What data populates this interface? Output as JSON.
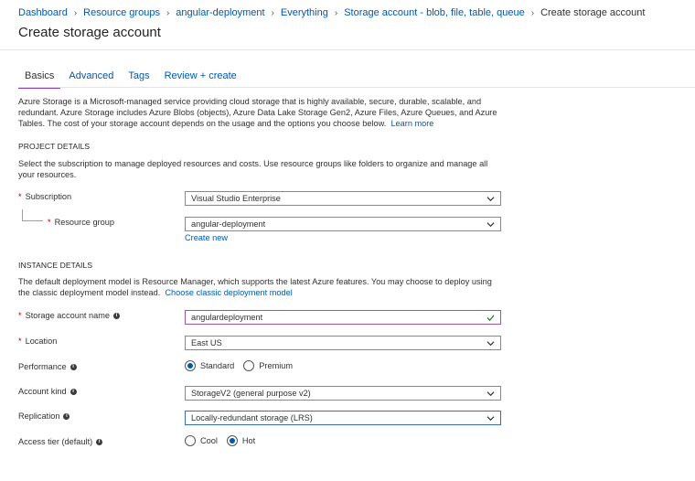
{
  "breadcrumb": {
    "items": [
      "Dashboard",
      "Resource groups",
      "angular-deployment",
      "Everything",
      "Storage account - blob, file, table, queue"
    ],
    "current": "Create storage account"
  },
  "page_title": "Create storage account",
  "tabs": [
    "Basics",
    "Advanced",
    "Tags",
    "Review + create"
  ],
  "intro": {
    "text": "Azure Storage is a Microsoft-managed service providing cloud storage that is highly available, secure, durable, scalable, and redundant. Azure Storage includes Azure Blobs (objects), Azure Data Lake Storage Gen2, Azure Files, Azure Queues, and Azure Tables. The cost of your storage account depends on the usage and the options you choose below.",
    "link": "Learn more"
  },
  "project": {
    "heading": "PROJECT DETAILS",
    "text": "Select the subscription to manage deployed resources and costs. Use resource groups like folders to organize and manage all your resources.",
    "subscription_label": "Subscription",
    "subscription_value": "Visual Studio Enterprise",
    "resource_group_label": "Resource group",
    "resource_group_value": "angular-deployment",
    "create_new": "Create new"
  },
  "instance": {
    "heading": "INSTANCE DETAILS",
    "text": "The default deployment model is Resource Manager, which supports the latest Azure features. You may choose to deploy using the classic deployment model instead.",
    "link": "Choose classic deployment model",
    "name_label": "Storage account name",
    "name_value": "angulardeployment",
    "location_label": "Location",
    "location_value": "East US",
    "performance_label": "Performance",
    "performance_options": [
      "Standard",
      "Premium"
    ],
    "account_kind_label": "Account kind",
    "account_kind_value": "StorageV2 (general purpose v2)",
    "replication_label": "Replication",
    "replication_value": "Locally-redundant storage (LRS)",
    "access_tier_label": "Access tier (default)",
    "access_tier_options": [
      "Cool",
      "Hot"
    ]
  },
  "colors": {
    "link": "#0058ad",
    "tab_underline": "#8a3bb4",
    "required": "#a80000",
    "valid_check": "#107c10"
  }
}
